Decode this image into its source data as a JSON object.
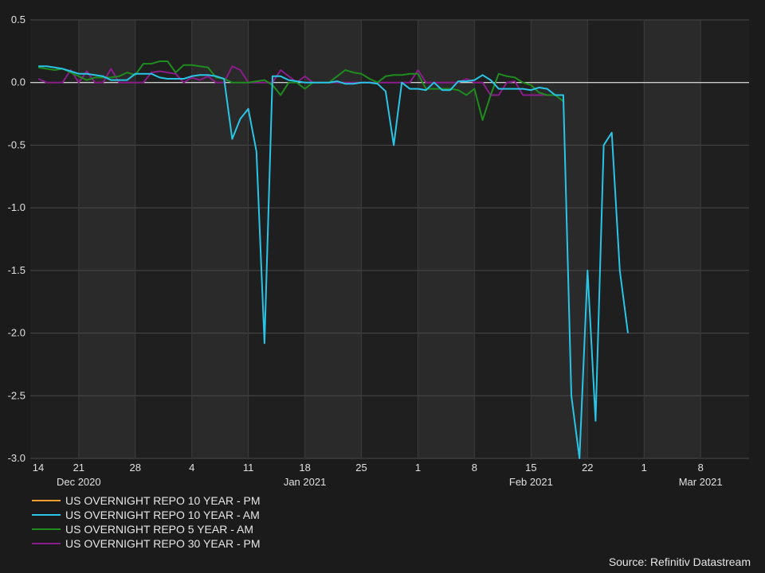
{
  "chart_data": {
    "type": "line",
    "x_start": "2020-12-15",
    "x_end": "2021-03-14",
    "ylim": [
      -3.0,
      0.5
    ],
    "y_ticks": [
      0.5,
      0.0,
      -0.5,
      -1.0,
      -1.5,
      -2.0,
      -2.5,
      -3.0
    ],
    "y_tick_labels": [
      "0.5",
      "0.0",
      "-0.5",
      "-1.0",
      "-1.5",
      "-2.0",
      "-2.5",
      "-3.0"
    ],
    "x_ticks": [
      {
        "date": "2020-12-14",
        "label": "14"
      },
      {
        "date": "2020-12-21",
        "label": "21"
      },
      {
        "date": "2020-12-28",
        "label": "28"
      },
      {
        "date": "2021-01-04",
        "label": "4"
      },
      {
        "date": "2021-01-11",
        "label": "11"
      },
      {
        "date": "2021-01-18",
        "label": "18"
      },
      {
        "date": "2021-01-25",
        "label": "25"
      },
      {
        "date": "2021-02-01",
        "label": "1"
      },
      {
        "date": "2021-02-08",
        "label": "8"
      },
      {
        "date": "2021-02-15",
        "label": "15"
      },
      {
        "date": "2021-02-22",
        "label": "22"
      },
      {
        "date": "2021-03-01",
        "label": "1"
      },
      {
        "date": "2021-03-08",
        "label": "8"
      }
    ],
    "month_labels": [
      {
        "date": "2020-12-21",
        "label": "Dec 2020"
      },
      {
        "date": "2021-01-18",
        "label": "Jan 2021"
      },
      {
        "date": "2021-02-15",
        "label": "Feb 2021"
      },
      {
        "date": "2021-03-08",
        "label": "Mar 2021"
      }
    ],
    "grid": true,
    "series": [
      {
        "name": "US OVERNIGHT REPO 10 YEAR - PM",
        "color": "#f0a030",
        "points": []
      },
      {
        "name": "US OVERNIGHT REPO 10 YEAR - AM",
        "color": "#29c5e6",
        "points": [
          [
            "2020-12-16",
            0.13
          ],
          [
            "2020-12-17",
            0.13
          ],
          [
            "2020-12-18",
            0.12
          ],
          [
            "2020-12-19",
            0.11
          ],
          [
            "2020-12-20",
            0.09
          ],
          [
            "2020-12-21",
            0.07
          ],
          [
            "2020-12-22",
            0.07
          ],
          [
            "2020-12-23",
            0.06
          ],
          [
            "2020-12-24",
            0.05
          ],
          [
            "2020-12-25",
            0.02
          ],
          [
            "2020-12-26",
            0.02
          ],
          [
            "2020-12-27",
            0.02
          ],
          [
            "2020-12-28",
            0.07
          ],
          [
            "2020-12-29",
            0.07
          ],
          [
            "2020-12-30",
            0.07
          ],
          [
            "2020-12-31",
            0.04
          ],
          [
            "2021-01-01",
            0.03
          ],
          [
            "2021-01-02",
            0.03
          ],
          [
            "2021-01-03",
            0.03
          ],
          [
            "2021-01-04",
            0.05
          ],
          [
            "2021-01-05",
            0.06
          ],
          [
            "2021-01-06",
            0.06
          ],
          [
            "2021-01-07",
            0.05
          ],
          [
            "2021-01-08",
            0.03
          ],
          [
            "2021-01-09",
            -0.45
          ],
          [
            "2021-01-10",
            -0.29
          ],
          [
            "2021-01-11",
            -0.21
          ],
          [
            "2021-01-12",
            -0.55
          ],
          [
            "2021-01-13",
            -2.08
          ],
          [
            "2021-01-14",
            0.05
          ],
          [
            "2021-01-15",
            0.05
          ],
          [
            "2021-01-16",
            0.02
          ],
          [
            "2021-01-17",
            0.01
          ],
          [
            "2021-01-18",
            0.0
          ],
          [
            "2021-01-19",
            0.0
          ],
          [
            "2021-01-20",
            0.0
          ],
          [
            "2021-01-21",
            0.0
          ],
          [
            "2021-01-22",
            0.01
          ],
          [
            "2021-01-23",
            -0.01
          ],
          [
            "2021-01-24",
            -0.01
          ],
          [
            "2021-01-25",
            0.0
          ],
          [
            "2021-01-26",
            0.0
          ],
          [
            "2021-01-27",
            -0.01
          ],
          [
            "2021-01-28",
            -0.07
          ],
          [
            "2021-01-29",
            -0.5
          ],
          [
            "2021-01-30",
            0.0
          ],
          [
            "2021-01-31",
            -0.05
          ],
          [
            "2021-02-01",
            -0.05
          ],
          [
            "2021-02-02",
            -0.06
          ],
          [
            "2021-02-03",
            0.0
          ],
          [
            "2021-02-04",
            -0.06
          ],
          [
            "2021-02-05",
            -0.06
          ],
          [
            "2021-02-06",
            0.01
          ],
          [
            "2021-02-07",
            0.01
          ],
          [
            "2021-02-08",
            0.02
          ],
          [
            "2021-02-09",
            0.06
          ],
          [
            "2021-02-10",
            0.02
          ],
          [
            "2021-02-11",
            -0.05
          ],
          [
            "2021-02-12",
            -0.05
          ],
          [
            "2021-02-13",
            -0.05
          ],
          [
            "2021-02-14",
            -0.05
          ],
          [
            "2021-02-15",
            -0.06
          ],
          [
            "2021-02-16",
            -0.04
          ],
          [
            "2021-02-17",
            -0.05
          ],
          [
            "2021-02-18",
            -0.1
          ],
          [
            "2021-02-19",
            -0.1
          ],
          [
            "2021-02-20",
            -2.5
          ],
          [
            "2021-02-21",
            -3.0
          ],
          [
            "2021-02-22",
            -1.5
          ],
          [
            "2021-02-23",
            -2.7
          ],
          [
            "2021-02-24",
            -0.5
          ],
          [
            "2021-02-25",
            -0.4
          ],
          [
            "2021-02-26",
            -1.5
          ],
          [
            "2021-02-27",
            -2.0
          ]
        ]
      },
      {
        "name": "US OVERNIGHT REPO 5 YEAR - AM",
        "color": "#1e8c1e",
        "points": [
          [
            "2020-12-16",
            0.12
          ],
          [
            "2020-12-17",
            0.11
          ],
          [
            "2020-12-18",
            0.1
          ],
          [
            "2020-12-19",
            0.11
          ],
          [
            "2020-12-20",
            0.08
          ],
          [
            "2020-12-21",
            0.05
          ],
          [
            "2020-12-22",
            0.02
          ],
          [
            "2020-12-23",
            0.04
          ],
          [
            "2020-12-24",
            0.04
          ],
          [
            "2020-12-25",
            0.04
          ],
          [
            "2020-12-26",
            0.05
          ],
          [
            "2020-12-27",
            0.08
          ],
          [
            "2020-12-28",
            0.06
          ],
          [
            "2020-12-29",
            0.15
          ],
          [
            "2020-12-30",
            0.15
          ],
          [
            "2020-12-31",
            0.17
          ],
          [
            "2021-01-01",
            0.17
          ],
          [
            "2021-01-02",
            0.08
          ],
          [
            "2021-01-03",
            0.14
          ],
          [
            "2021-01-04",
            0.14
          ],
          [
            "2021-01-05",
            0.13
          ],
          [
            "2021-01-06",
            0.12
          ],
          [
            "2021-01-07",
            0.04
          ],
          [
            "2021-01-08",
            0.03
          ],
          [
            "2021-01-09",
            0.0
          ],
          [
            "2021-01-10",
            0.0
          ],
          [
            "2021-01-11",
            0.0
          ],
          [
            "2021-01-12",
            0.01
          ],
          [
            "2021-01-13",
            0.02
          ],
          [
            "2021-01-14",
            -0.02
          ],
          [
            "2021-01-15",
            -0.1
          ],
          [
            "2021-01-16",
            0.0
          ],
          [
            "2021-01-17",
            0.0
          ],
          [
            "2021-01-18",
            -0.05
          ],
          [
            "2021-01-19",
            0.0
          ],
          [
            "2021-01-20",
            0.0
          ],
          [
            "2021-01-21",
            0.0
          ],
          [
            "2021-01-22",
            0.05
          ],
          [
            "2021-01-23",
            0.1
          ],
          [
            "2021-01-24",
            0.08
          ],
          [
            "2021-01-25",
            0.07
          ],
          [
            "2021-01-26",
            0.03
          ],
          [
            "2021-01-27",
            0.0
          ],
          [
            "2021-01-28",
            0.05
          ],
          [
            "2021-01-29",
            0.06
          ],
          [
            "2021-01-30",
            0.06
          ],
          [
            "2021-01-31",
            0.07
          ],
          [
            "2021-02-01",
            0.07
          ],
          [
            "2021-02-02",
            -0.05
          ],
          [
            "2021-02-03",
            -0.05
          ],
          [
            "2021-02-04",
            -0.05
          ],
          [
            "2021-02-05",
            -0.05
          ],
          [
            "2021-02-06",
            -0.06
          ],
          [
            "2021-02-07",
            -0.1
          ],
          [
            "2021-02-08",
            -0.05
          ],
          [
            "2021-02-09",
            -0.3
          ],
          [
            "2021-02-10",
            -0.1
          ],
          [
            "2021-02-11",
            0.07
          ],
          [
            "2021-02-12",
            0.05
          ],
          [
            "2021-02-13",
            0.04
          ],
          [
            "2021-02-14",
            0.0
          ],
          [
            "2021-02-15",
            -0.02
          ],
          [
            "2021-02-16",
            -0.08
          ],
          [
            "2021-02-17",
            -0.1
          ],
          [
            "2021-02-18",
            -0.1
          ],
          [
            "2021-02-19",
            -0.15
          ]
        ]
      },
      {
        "name": "US OVERNIGHT REPO 30 YEAR - PM",
        "color": "#8a1d8a",
        "points": [
          [
            "2020-12-16",
            0.03
          ],
          [
            "2020-12-17",
            0.0
          ],
          [
            "2020-12-18",
            0.0
          ],
          [
            "2020-12-19",
            0.0
          ],
          [
            "2020-12-20",
            0.1
          ],
          [
            "2020-12-21",
            0.0
          ],
          [
            "2020-12-22",
            0.09
          ],
          [
            "2020-12-23",
            0.0
          ],
          [
            "2020-12-24",
            0.0
          ],
          [
            "2020-12-25",
            0.11
          ],
          [
            "2020-12-26",
            0.0
          ],
          [
            "2020-12-27",
            0.0
          ],
          [
            "2020-12-28",
            0.0
          ],
          [
            "2020-12-29",
            0.0
          ],
          [
            "2020-12-30",
            0.08
          ],
          [
            "2020-12-31",
            0.09
          ],
          [
            "2021-01-01",
            0.08
          ],
          [
            "2021-01-02",
            0.07
          ],
          [
            "2021-01-03",
            0.0
          ],
          [
            "2021-01-04",
            0.04
          ],
          [
            "2021-01-05",
            0.02
          ],
          [
            "2021-01-06",
            0.05
          ],
          [
            "2021-01-07",
            0.0
          ],
          [
            "2021-01-08",
            0.0
          ],
          [
            "2021-01-09",
            0.13
          ],
          [
            "2021-01-10",
            0.1
          ],
          [
            "2021-01-11",
            0.0
          ],
          [
            "2021-01-12",
            0.0
          ],
          [
            "2021-01-13",
            0.0
          ],
          [
            "2021-01-14",
            0.0
          ],
          [
            "2021-01-15",
            0.1
          ],
          [
            "2021-01-16",
            0.05
          ],
          [
            "2021-01-17",
            0.0
          ],
          [
            "2021-01-18",
            0.05
          ],
          [
            "2021-01-19",
            0.0
          ],
          [
            "2021-01-20",
            0.0
          ],
          [
            "2021-01-21",
            0.0
          ],
          [
            "2021-01-22",
            0.0
          ],
          [
            "2021-01-23",
            0.0
          ],
          [
            "2021-01-24",
            0.0
          ],
          [
            "2021-01-25",
            0.0
          ],
          [
            "2021-01-26",
            0.0
          ],
          [
            "2021-01-27",
            0.0
          ],
          [
            "2021-01-28",
            0.0
          ],
          [
            "2021-01-29",
            0.0
          ],
          [
            "2021-01-30",
            0.0
          ],
          [
            "2021-01-31",
            0.0
          ],
          [
            "2021-02-01",
            0.1
          ],
          [
            "2021-02-02",
            0.0
          ],
          [
            "2021-02-03",
            0.0
          ],
          [
            "2021-02-04",
            0.0
          ],
          [
            "2021-02-05",
            0.0
          ],
          [
            "2021-02-06",
            0.0
          ],
          [
            "2021-02-07",
            0.03
          ],
          [
            "2021-02-08",
            0.0
          ],
          [
            "2021-02-09",
            0.0
          ],
          [
            "2021-02-10",
            -0.1
          ],
          [
            "2021-02-11",
            -0.1
          ],
          [
            "2021-02-12",
            0.0
          ],
          [
            "2021-02-13",
            0.01
          ],
          [
            "2021-02-14",
            -0.1
          ],
          [
            "2021-02-15",
            -0.1
          ],
          [
            "2021-02-16",
            -0.1
          ],
          [
            "2021-02-17",
            -0.1
          ],
          [
            "2021-02-18",
            -0.1
          ]
        ]
      }
    ]
  },
  "source_text": "Source: Refinitiv Datastream"
}
